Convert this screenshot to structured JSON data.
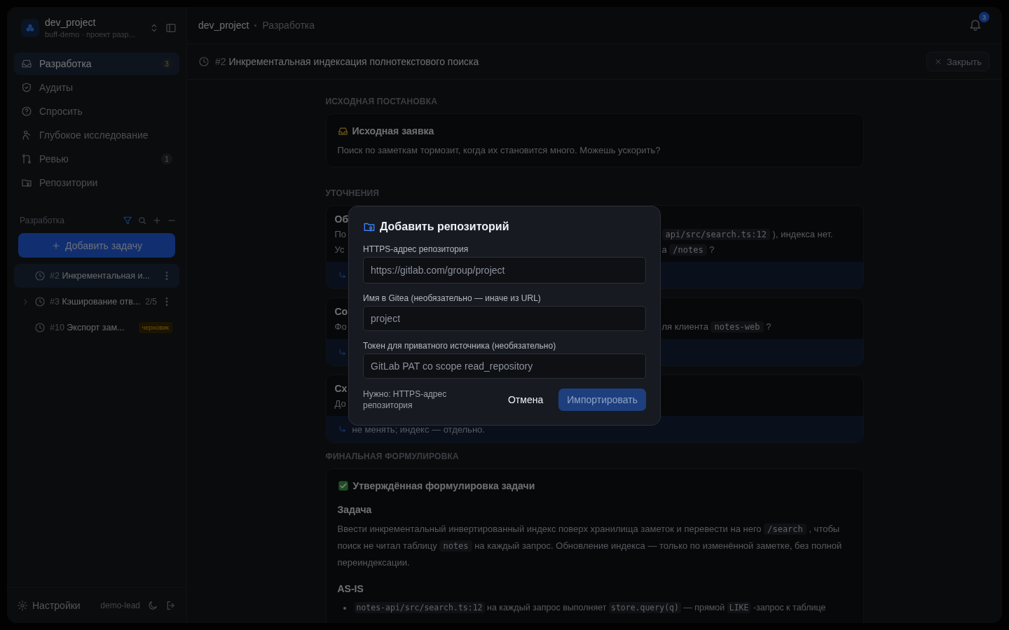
{
  "sidebar": {
    "workspace": {
      "name": "dev_project",
      "subtitle": "buff-demo · проект разр..."
    },
    "nav": [
      {
        "label": "Разработка",
        "badge": "3",
        "selected": true
      },
      {
        "label": "Аудиты",
        "selected": false
      },
      {
        "label": "Спросить",
        "selected": false
      },
      {
        "label": "Глубокое исследование",
        "selected": false
      },
      {
        "label": "Ревью",
        "badge": "1",
        "selected": false
      },
      {
        "label": "Репозитории",
        "selected": false
      }
    ],
    "section": {
      "title": "Разработка",
      "filter_on": true,
      "add_button": "Добавить задачу"
    },
    "tasks": [
      {
        "number": "#2",
        "title": "Инкрементальная и...",
        "selected": true
      },
      {
        "number": "#3",
        "title": "Кэширование отв...",
        "progress": "2/5",
        "expanded": false,
        "selected": false
      },
      {
        "number": "#10",
        "title": "Экспорт зам...",
        "badge": "черновик",
        "selected": false
      }
    ],
    "footer": {
      "settings": "Настройки",
      "user": "demo-lead"
    }
  },
  "header": {
    "breadcrumb": [
      "dev_project",
      "Разработка"
    ],
    "notifications": "3"
  },
  "task_bar": {
    "number": "#2",
    "title": "Инкрементальная индексация полнотекстового поиска",
    "close": "Закрыть"
  },
  "sections": [
    {
      "title": "ИСХОДНАЯ ПОСТАНОВКА",
      "cards": [
        {
          "kind": "request",
          "title": "Исходная заявка",
          "text": "Поиск по заметкам тормозит, когда их становится много. Можешь ускорить?"
        }
      ]
    },
    {
      "title": "УТОЧНЕНИЯ",
      "cards": [
        {
          "kind": "clarification",
          "title": "Об",
          "lines": [
            {
              "left": "По",
              "right": [
                {
                  "kind": "code",
                  "text": "api/src/search.ts:12"
                },
                {
                  "kind": "text",
                  "text": " ), индекса нет."
                }
              ]
            },
            {
              "left": "Ус",
              "right": [
                {
                  "kind": "text",
                  "text": "а "
                },
                {
                  "kind": "code",
                  "text": "/notes"
                },
                {
                  "kind": "text",
                  "text": " ?"
                }
              ]
            }
          ]
        },
        {
          "kind": "clarification",
          "title": "Со",
          "lines": [
            {
              "left": "Фо",
              "right": [
                {
                  "kind": "text",
                  "text": "ля клиента "
                },
                {
                  "kind": "code",
                  "text": "notes-web"
                },
                {
                  "kind": "text",
                  "text": " ?"
                }
              ]
            }
          ]
        },
        {
          "kind": "clarification",
          "title": "Сх",
          "lines": [
            {
              "left": "До"
            }
          ],
          "answer": "не менять; индекс — отдельно."
        }
      ]
    },
    {
      "title": "ФИНАЛЬНАЯ ФОРМУЛИРОВКА",
      "cards": [
        {
          "kind": "final",
          "title": "Утверждённая формулировка задачи",
          "blocks": [
            {
              "kind": "heading",
              "text": "Задача"
            },
            {
              "kind": "paragraph",
              "segments": [
                {
                  "kind": "text",
                  "text": "Ввести инкрементальный инвертированный индекс поверх хранилища заметок и перевести на него "
                },
                {
                  "kind": "code",
                  "text": "/search"
                },
                {
                  "kind": "text",
                  "text": " , чтобы поиск не читал таблицу "
                },
                {
                  "kind": "code",
                  "text": "notes"
                },
                {
                  "kind": "text",
                  "text": " на каждый запрос. Обновление индекса — только по изменённой заметке, без полной переиндексации."
                }
              ]
            },
            {
              "kind": "heading",
              "text": "AS-IS"
            },
            {
              "kind": "bullet",
              "segments": [
                {
                  "kind": "code",
                  "text": "notes-api/src/search.ts:12"
                },
                {
                  "kind": "text",
                  "text": " на каждый запрос выполняет "
                },
                {
                  "kind": "code",
                  "text": "store.query(q)"
                },
                {
                  "kind": "text",
                  "text": " — прямой "
                },
                {
                  "kind": "code",
                  "text": "LIKE"
                },
                {
                  "kind": "text",
                  "text": " -запрос к таблице"
                }
              ]
            }
          ]
        }
      ]
    }
  ],
  "modal": {
    "title": "Добавить репозиторий",
    "fields": [
      {
        "label": "HTTPS-адрес репозитория",
        "placeholder": "https://gitlab.com/group/project"
      },
      {
        "label": "Имя в Gitea (необязательно — иначе из URL)",
        "placeholder": "project"
      },
      {
        "label": "Токен для приватного источника (необязательно)",
        "placeholder": "GitLab PAT со scope read_repository"
      }
    ],
    "hint": "Нужно: HTTPS-адрес репозитория",
    "cancel": "Отмена",
    "submit": {
      "label": "Импортировать",
      "disabled": true
    }
  }
}
